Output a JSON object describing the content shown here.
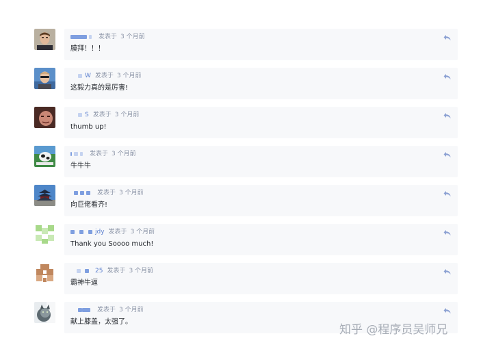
{
  "comments": [
    {
      "user_suffix": "",
      "posted": "发表于",
      "time": "3 个月前",
      "text": "膜拜！！！",
      "avatar": "portrait-man-icon"
    },
    {
      "user_suffix": "W",
      "posted": "发表于",
      "time": "3 个月前",
      "text": "这毅力真的是厉害!",
      "avatar": "man-sunglasses-icon"
    },
    {
      "user_suffix": "S",
      "posted": "发表于",
      "time": "3 个月前",
      "text": "thumb up!",
      "avatar": "face-portrait-icon"
    },
    {
      "user_suffix": "",
      "posted": "发表于",
      "time": "3 个月前",
      "text": "牛牛牛",
      "avatar": "cow-photo-icon"
    },
    {
      "user_suffix": "",
      "posted": "发表于",
      "time": "3 个月前",
      "text": "向巨佬看齐!",
      "avatar": "temple-photo-icon"
    },
    {
      "user_suffix": "jdy",
      "posted": "发表于",
      "time": "3 个月前",
      "text": "Thank you Soooo much!",
      "avatar": "green-identicon-icon"
    },
    {
      "user_suffix": "25",
      "posted": "发表于",
      "time": "3 个月前",
      "text": "霸神牛逼",
      "avatar": "brown-identicon-icon"
    },
    {
      "user_suffix": "",
      "posted": "发表于",
      "time": "3 个月前",
      "text": "献上膝盖，太强了。",
      "avatar": "cat-photo-icon"
    }
  ],
  "watermark": "知乎 @程序员吴师兄",
  "colors": {
    "accent": "#5b7fce",
    "bubble": "#f7f8fa",
    "meta": "#8a93a6"
  }
}
